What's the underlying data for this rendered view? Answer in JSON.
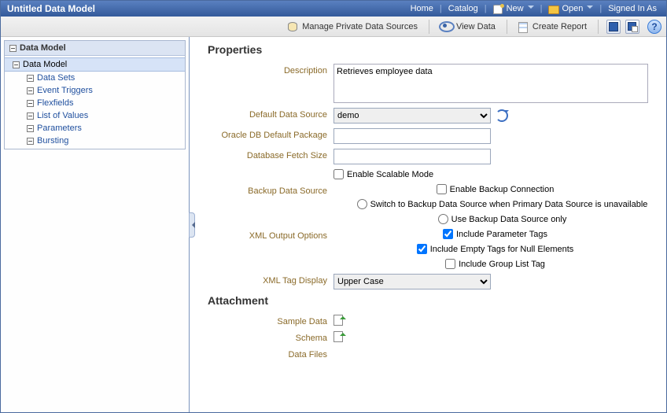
{
  "titlebar": {
    "title": "Untitled Data Model",
    "home": "Home",
    "catalog": "Catalog",
    "new": "New",
    "open": "Open",
    "signed_in_as": "Signed In As"
  },
  "toolbar": {
    "manage_sources": "Manage Private Data Sources",
    "view_data": "View Data",
    "create_report": "Create Report"
  },
  "sidebar": {
    "header": "Data Model",
    "root": "Data Model",
    "items": [
      "Data Sets",
      "Event Triggers",
      "Flexfields",
      "List of Values",
      "Parameters",
      "Bursting"
    ]
  },
  "properties": {
    "title": "Properties",
    "description_label": "Description",
    "description_value": "Retrieves employee data",
    "default_ds_label": "Default Data Source",
    "default_ds_value": "demo",
    "oracle_pkg_label": "Oracle DB Default Package",
    "fetch_size_label": "Database Fetch Size",
    "scalable_label": "Enable Scalable Mode",
    "backup_ds_label": "Backup Data Source",
    "enable_backup": "Enable Backup Connection",
    "switch_backup": "Switch to Backup Data Source when Primary Data Source is unavailable",
    "use_backup_only": "Use Backup Data Source only",
    "xml_output_label": "XML Output Options",
    "include_param_tags": "Include Parameter Tags",
    "include_empty_tags": "Include Empty Tags for Null Elements",
    "include_group_list": "Include Group List Tag",
    "xml_tag_display_label": "XML Tag Display",
    "xml_tag_display_value": "Upper Case"
  },
  "attachment": {
    "title": "Attachment",
    "sample_data": "Sample Data",
    "schema": "Schema",
    "data_files": "Data Files"
  }
}
